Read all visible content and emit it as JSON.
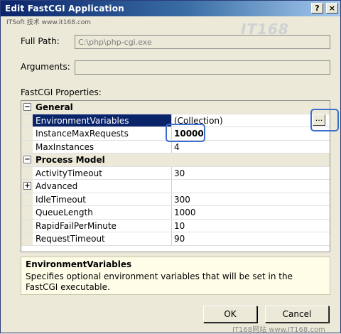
{
  "window": {
    "title": "Edit FastCGI Application",
    "subtitle": "ITSoft 技术 www.it168.com",
    "help_label": "?",
    "close_label": "×",
    "watermark_top": "IT168"
  },
  "form": {
    "full_path_label": "Full Path:",
    "full_path_value": "C:\\php\\php-cgi.exe",
    "arguments_label": "Arguments:",
    "arguments_value": "",
    "properties_label": "FastCGI Properties:"
  },
  "grid": {
    "general": {
      "label": "General",
      "toggle": "−",
      "rows": [
        {
          "name": "EnvironmentVariables",
          "value": "(Collection)",
          "button": "..."
        },
        {
          "name": "InstanceMaxRequests",
          "value": "10000"
        },
        {
          "name": "MaxInstances",
          "value": "4"
        }
      ]
    },
    "process_model": {
      "label": "Process Model",
      "toggle": "−",
      "rows": [
        {
          "name": "ActivityTimeout",
          "value": "30"
        },
        {
          "name": "Advanced",
          "value": "",
          "toggle": "+"
        },
        {
          "name": "IdleTimeout",
          "value": "300"
        },
        {
          "name": "QueueLength",
          "value": "1000"
        },
        {
          "name": "RapidFailPerMinute",
          "value": "10"
        },
        {
          "name": "RequestTimeout",
          "value": "90"
        }
      ]
    }
  },
  "description": {
    "title": "EnvironmentVariables",
    "text": "Specifies optional environment variables that will be set in the FastCGI executable."
  },
  "buttons": {
    "ok": "OK",
    "cancel": "Cancel"
  },
  "footer": {
    "watermark": "IT168网站 www.IT168.com"
  },
  "colors": {
    "titlebar_start": "#0a246a",
    "selection": "#0a246a",
    "highlight_ring": "#3a6fd0",
    "description_bg": "#fffde8"
  }
}
